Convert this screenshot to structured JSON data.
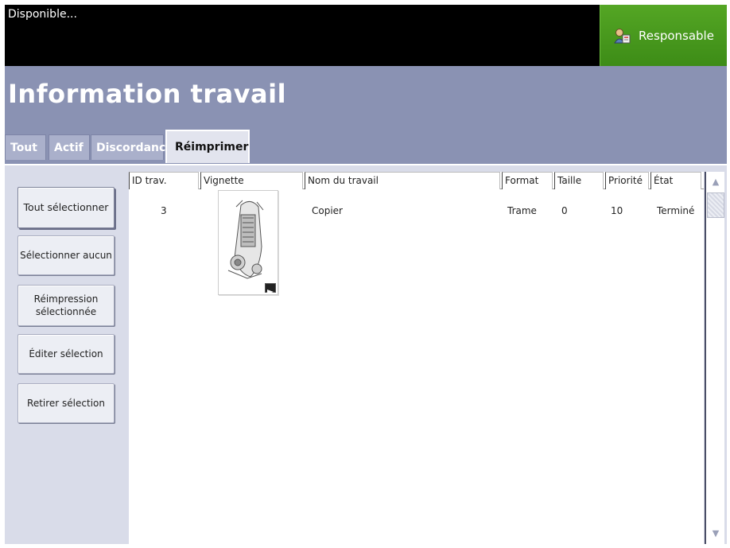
{
  "status": {
    "text": "Disponible..."
  },
  "user_button": {
    "label": "Responsable",
    "icon": "user-icon"
  },
  "header": {
    "title": "Information travail"
  },
  "tabs": [
    {
      "label": "Tout",
      "active": false
    },
    {
      "label": "Actif",
      "active": false
    },
    {
      "label": "Discordance",
      "active": false
    },
    {
      "label": "Réimprimer",
      "active": true
    }
  ],
  "sidebar": {
    "select_all": "Tout sélectionner",
    "select_none": "Sélectionner aucun",
    "reprint_line1": "Réimpression",
    "reprint_line2": "sélectionnée",
    "edit": "Éditer sélection",
    "remove": "Retirer sélection"
  },
  "table": {
    "columns": [
      "ID trav.",
      "Vignette",
      "Nom du travail",
      "Format",
      "Taille",
      "Priorité",
      "État"
    ],
    "rows": [
      {
        "id": "3",
        "name": "Copier",
        "format": "Trame",
        "size": "0",
        "priority": "10",
        "state": "Terminé"
      }
    ]
  },
  "colors": {
    "accent_green": "#4c9f20",
    "header_bg": "#8a92b3",
    "content_bg": "#d9dce9"
  }
}
